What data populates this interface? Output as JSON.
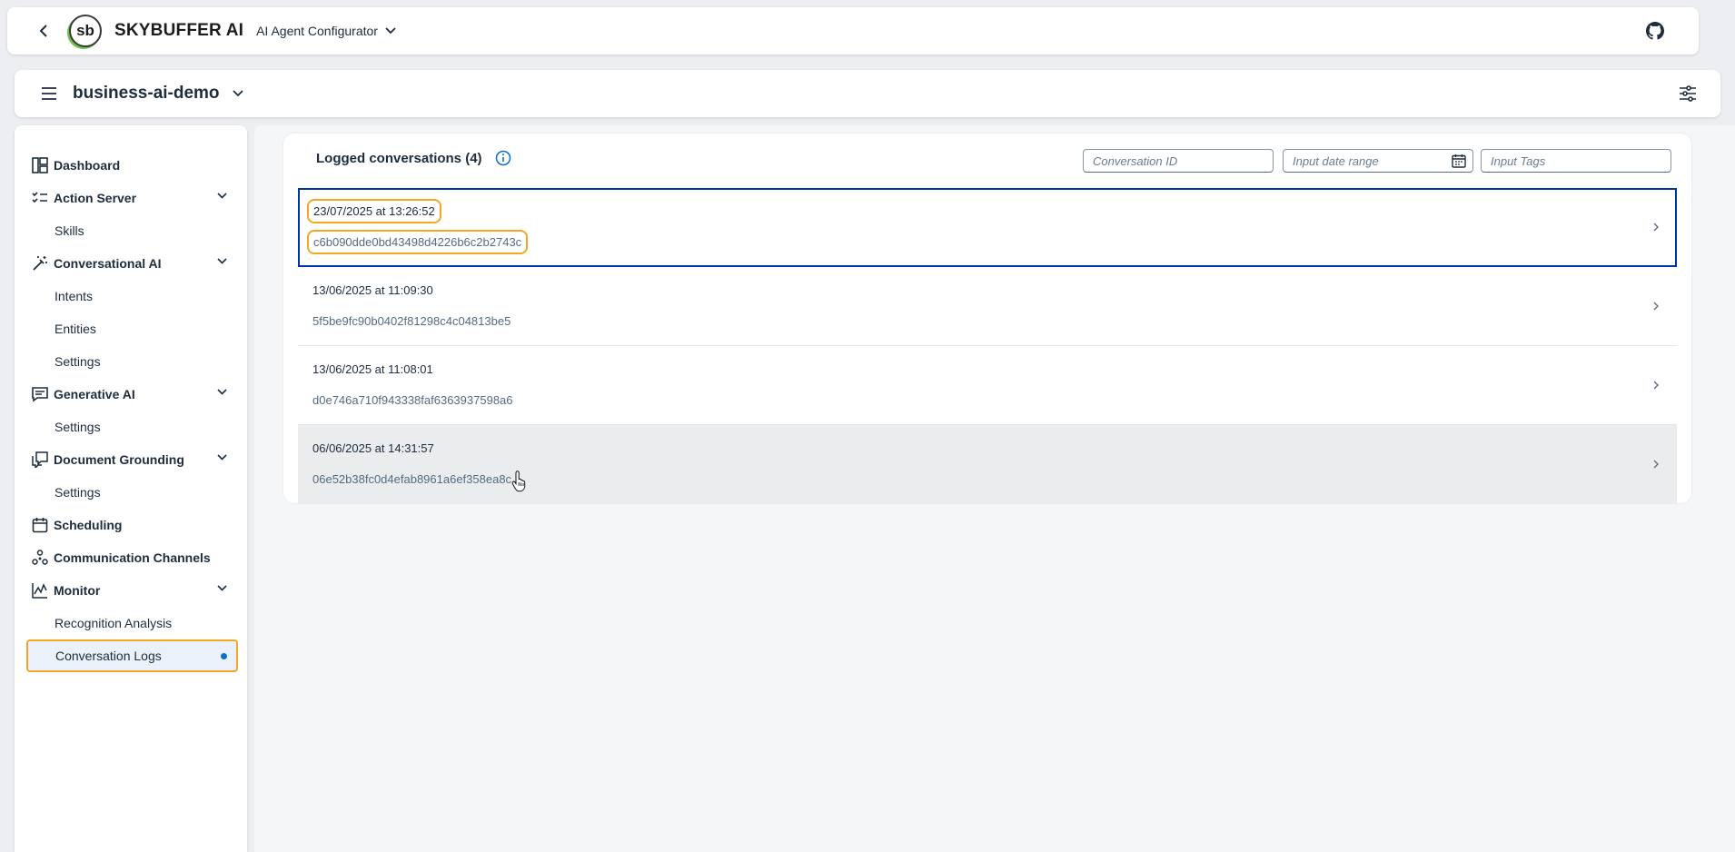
{
  "shell": {
    "logo_text": "sb",
    "brand": "SKYBUFFER AI",
    "product": "AI Agent Configurator"
  },
  "subheader": {
    "workspace": "business-ai-demo"
  },
  "sidebar": {
    "items": [
      {
        "label": "Dashboard",
        "icon": "dashboard-icon"
      },
      {
        "label": "Action Server",
        "icon": "checklist-icon"
      },
      {
        "label": "Skills"
      },
      {
        "label": "Conversational AI",
        "icon": "magic-wand-icon"
      },
      {
        "label": "Intents"
      },
      {
        "label": "Entities"
      },
      {
        "label": "Settings"
      },
      {
        "label": "Generative AI",
        "icon": "chat-icon"
      },
      {
        "label": "Settings"
      },
      {
        "label": "Document Grounding",
        "icon": "document-chat-icon"
      },
      {
        "label": "Settings"
      },
      {
        "label": "Scheduling",
        "icon": "calendar-icon"
      },
      {
        "label": "Communication Channels",
        "icon": "network-icon"
      },
      {
        "label": "Monitor",
        "icon": "line-chart-icon"
      },
      {
        "label": "Recognition Analysis"
      },
      {
        "label": "Conversation Logs"
      }
    ]
  },
  "main": {
    "title": "Logged conversations (4)",
    "filters": {
      "conversation_id_placeholder": "Conversation ID",
      "date_range_placeholder": "Input date range",
      "tags_placeholder": "Input Tags"
    },
    "conversations": [
      {
        "date": "23/07/2025 at 13:26:52",
        "id": "c6b090dde0bd43498d4226b6c2b2743c"
      },
      {
        "date": "13/06/2025 at 11:09:30",
        "id": "5f5be9fc90b0402f81298c4c04813be5"
      },
      {
        "date": "13/06/2025 at 11:08:01",
        "id": "d0e746a710f943338faf6363937598a6"
      },
      {
        "date": "06/06/2025 at 14:31:57",
        "id": "06e52b38fc0d4efab8961a6ef358ea8c"
      }
    ]
  },
  "colors": {
    "accent": "#0a6ed1",
    "highlight": "#f5a623",
    "focus": "#0032a5"
  }
}
